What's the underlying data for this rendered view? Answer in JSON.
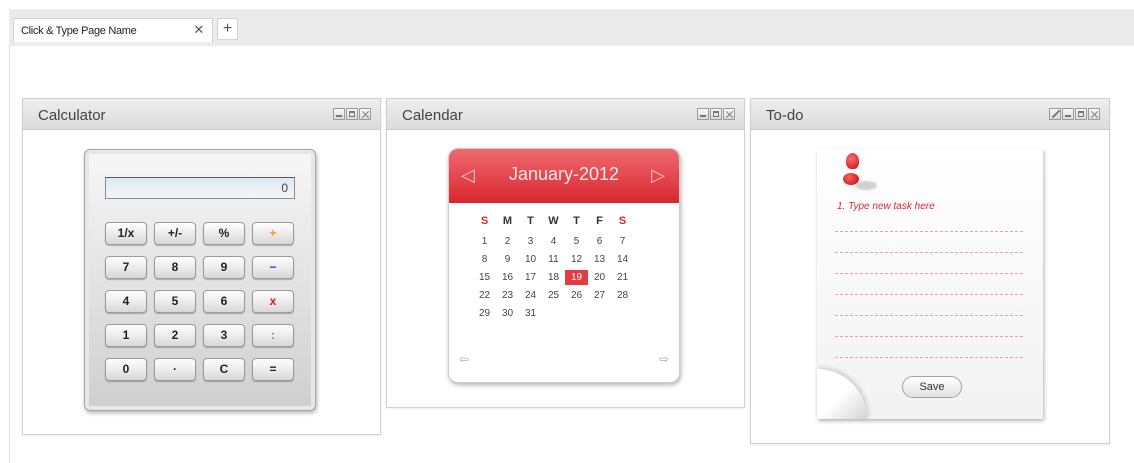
{
  "tabs": {
    "active_label": "Click & Type Page Name",
    "close_glyph": "✕",
    "add_glyph": "+"
  },
  "widgets": {
    "calculator": {
      "title": "Calculator",
      "display": "0",
      "keys": [
        {
          "label": "1/x",
          "color": "default"
        },
        {
          "label": "+/-",
          "color": "default"
        },
        {
          "label": "%",
          "color": "default"
        },
        {
          "label": "+",
          "color": "orange"
        },
        {
          "label": "7",
          "color": "default"
        },
        {
          "label": "8",
          "color": "default"
        },
        {
          "label": "9",
          "color": "default"
        },
        {
          "label": "−",
          "color": "blue"
        },
        {
          "label": "4",
          "color": "default"
        },
        {
          "label": "5",
          "color": "default"
        },
        {
          "label": "6",
          "color": "default"
        },
        {
          "label": "x",
          "color": "red"
        },
        {
          "label": "1",
          "color": "default"
        },
        {
          "label": "2",
          "color": "default"
        },
        {
          "label": "3",
          "color": "default"
        },
        {
          "label": ":",
          "color": "green"
        },
        {
          "label": "0",
          "color": "default"
        },
        {
          "label": "·",
          "color": "default"
        },
        {
          "label": "C",
          "color": "default"
        },
        {
          "label": "=",
          "color": "default"
        }
      ]
    },
    "calendar": {
      "title": "Calendar",
      "month": "January-2012",
      "prev_glyph": "◁",
      "next_glyph": "▷",
      "weekdays": [
        "S",
        "M",
        "T",
        "W",
        "T",
        "F",
        "S"
      ],
      "weeks": [
        [
          "1",
          "2",
          "3",
          "4",
          "5",
          "6",
          "7"
        ],
        [
          "8",
          "9",
          "10",
          "11",
          "12",
          "13",
          "14"
        ],
        [
          "15",
          "16",
          "17",
          "18",
          "19",
          "20",
          "21"
        ],
        [
          "22",
          "23",
          "24",
          "25",
          "26",
          "27",
          "28"
        ],
        [
          "29",
          "30",
          "31",
          "",
          "",
          "",
          ""
        ]
      ],
      "today": "19",
      "nav_left_glyph": "⇦",
      "nav_right_glyph": "⇨"
    },
    "todo": {
      "title": "To-do",
      "first_task": "1. Type new task here",
      "save_label": "Save"
    }
  },
  "colors": {
    "accent_red": "#d9262f",
    "key_orange": "#f39b1c",
    "key_blue": "#2b43c8",
    "key_red": "#d21e1e",
    "key_green": "#4cae48"
  },
  "icons": {
    "window_controls": [
      "minimize-icon",
      "maximize-icon",
      "close-icon"
    ],
    "todo_extra_control": "edit-icon",
    "note_decoration": "pushpin-icon"
  }
}
